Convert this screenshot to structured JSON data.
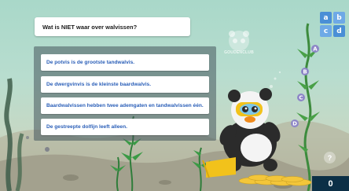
{
  "question": "Wat is NIET waar over walvissen?",
  "answers": [
    "De potvis is de grootste tandwalvis.",
    "De dwergvinvis is de kleinste baardwalvis.",
    "Baardwalvissen hebben twee ademgaten en tandwalvissen één.",
    "De gestreepte dolfijn leeft alleen."
  ],
  "abcd_button": {
    "letters": [
      "a",
      "b",
      "c",
      "d"
    ]
  },
  "help_button": {
    "label": "?"
  },
  "logo": {
    "text": "GOUDENCLUB"
  },
  "score": "0",
  "colors": {
    "answer_text": "#2b5fb8",
    "panel": "#46565c",
    "abcd": "#4a8fd6",
    "score_bg": "#0c2f46",
    "water_top": "#a9d8c9",
    "seabed": "#9c9a88"
  },
  "icons": [
    "panda-diver-icon",
    "panda-logo-icon",
    "seaweed-icon",
    "bubble-letter-icon",
    "coin-stack-icon",
    "abcd-icon",
    "help-icon"
  ]
}
